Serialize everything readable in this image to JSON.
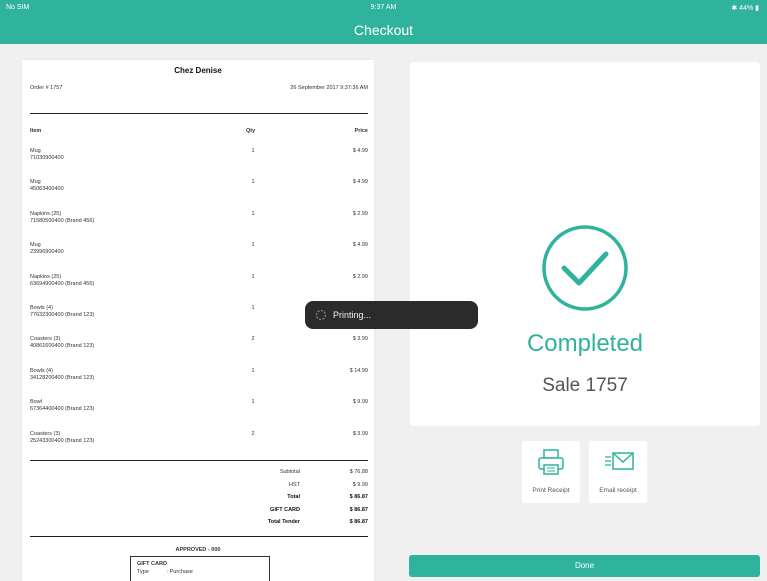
{
  "status_bar": {
    "carrier": "No SIM",
    "time": "9:37 AM",
    "battery": "44%"
  },
  "header": {
    "title": "Checkout"
  },
  "receipt": {
    "store_name": "Chez Denise",
    "order_label": "Order # 1757",
    "datetime": "26 September 2017 9:37:36 AM",
    "columns": {
      "item": "Item",
      "qty": "Qty",
      "price": "Price"
    },
    "items": [
      {
        "name": "Mug",
        "sku": "71030900400",
        "qty": "1",
        "price": "$ 4.99"
      },
      {
        "name": "Mug",
        "sku": "45063400400",
        "qty": "1",
        "price": "$ 4.99"
      },
      {
        "name": "Napkins (25)",
        "sku": "71580500400 (Brand 456)",
        "qty": "1",
        "price": "$ 2.99"
      },
      {
        "name": "Mug",
        "sku": "23996900400",
        "qty": "1",
        "price": "$ 4.99"
      },
      {
        "name": "Napkins (25)",
        "sku": "63694900400 (Brand 456)",
        "qty": "1",
        "price": "$ 2.99"
      },
      {
        "name": "Bowls (4)",
        "sku": "77632300400 (Brand 123)",
        "qty": "1",
        "price": ""
      },
      {
        "name": "Coasters (3)",
        "sku": "40861600400 (Brand 123)",
        "qty": "2",
        "price": "$ 3.99"
      },
      {
        "name": "Bowls (4)",
        "sku": "34128200400 (Brand 123)",
        "qty": "1",
        "price": "$ 14.99"
      },
      {
        "name": "Bowl",
        "sku": "67364400400 (Brand 123)",
        "qty": "1",
        "price": "$ 9.99"
      },
      {
        "name": "Coasters (3)",
        "sku": "25243300400 (Brand 123)",
        "qty": "2",
        "price": "$ 3.99"
      }
    ],
    "totals": [
      {
        "label": "Subtotal",
        "value": "$ 76.88",
        "bold": false
      },
      {
        "label": "HST",
        "value": "$ 9.99",
        "bold": false
      },
      {
        "label": "Total",
        "value": "$ 86.87",
        "bold": true
      },
      {
        "label": "GIFT CARD",
        "value": "$ 86.87",
        "bold": true
      },
      {
        "label": "Total Tender",
        "value": "$ 86.87",
        "bold": true
      }
    ],
    "approved": "APPROVED - 000",
    "gift_card": {
      "title": "GIFT CARD",
      "type_label": "Type",
      "type_value": ": Purchase"
    }
  },
  "result": {
    "status": "Completed",
    "sale": "Sale 1757",
    "accent": "#2fb39c"
  },
  "actions": {
    "print_label": "Print Receipt",
    "email_label": "Email receipt"
  },
  "done_label": "Done",
  "toast": {
    "text": "Printing..."
  }
}
